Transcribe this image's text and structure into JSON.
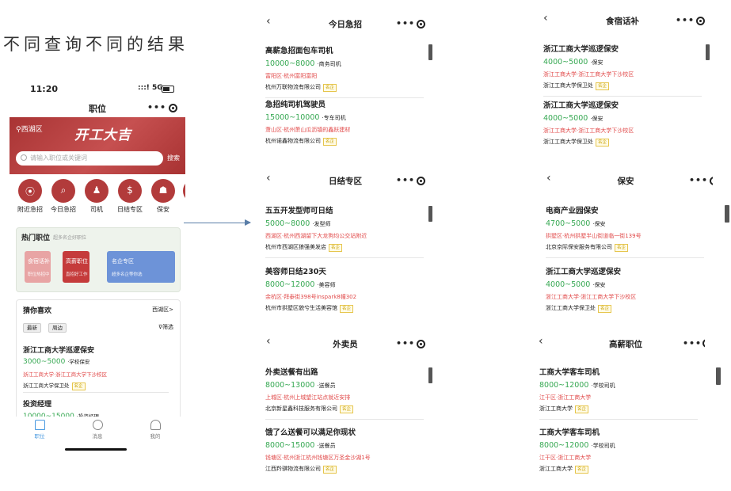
{
  "caption": "不同查询不同的结果",
  "phone": {
    "time": "11:20",
    "signal": "5G",
    "title": "职位",
    "district": "西湖区",
    "slogan": "开工大吉",
    "search_placeholder": "请输入职位或关键词",
    "search_button": "搜索",
    "categories": [
      {
        "label": "附近急招",
        "icon": "⦿"
      },
      {
        "label": "今日急招",
        "icon": "⌕"
      },
      {
        "label": "司机",
        "icon": "♟"
      },
      {
        "label": "日结专区",
        "icon": "$"
      },
      {
        "label": "保安",
        "icon": "☗"
      }
    ],
    "hot": {
      "title": "热门职位",
      "subtitle": "超多名企好职位",
      "tiles": [
        {
          "title": "食宿话补",
          "sub": "职位热招中",
          "color": "#e8a4a4"
        },
        {
          "title": "高薪职位",
          "sub": "直招好工作",
          "color": "#c53b3b"
        },
        {
          "title": "名企专区",
          "sub": "超多名企等你选",
          "color": "#6d93d8"
        }
      ]
    },
    "guess": {
      "title": "猜你喜欢",
      "area": "西湖区>",
      "chips": [
        "最新",
        "周边"
      ],
      "filter": "筛选",
      "job1": {
        "title": "浙江工商大学巡逻保安",
        "salary": "3000~5000",
        "type": "·学校保安",
        "location": "浙江工商大学·浙江工商大学下沙校区",
        "company": "浙江工商大学保卫处",
        "badge": "名企"
      },
      "job2": {
        "title": "投资经理",
        "salary": "10000~15000",
        "type": "·投资经理"
      }
    },
    "tabs": [
      "职位",
      "消息",
      "我的"
    ]
  },
  "panels": [
    {
      "title": "今日急招",
      "jobs": [
        {
          "title": "高薪急招面包车司机",
          "salary": "10000~8000",
          "type": "·商务司机",
          "location": "富阳区·杭州富阳富阳",
          "company": "杭州万联物流有限公司",
          "badge": "名企"
        },
        {
          "title": "急招纯司机驾驶员",
          "salary": "15000~10000",
          "type": "·专车司机",
          "location": "萧山区·杭州萧山瓜沥镇的鑫跃建材",
          "company": "杭州诺鑫物流有限公司",
          "badge": "名企"
        }
      ]
    },
    {
      "title": "食宿话补",
      "jobs": [
        {
          "title": "浙江工商大学巡逻保安",
          "salary": "4000~5000",
          "type": "·保安",
          "location": "浙江工商大学·浙江工商大学下沙校区",
          "company": "浙江工商大学保卫处",
          "badge": "名企"
        },
        {
          "title": "浙江工商大学巡逻保安",
          "salary": "4000~5000",
          "type": "·保安",
          "location": "浙江工商大学·浙江工商大学下沙校区",
          "company": "浙江工商大学保卫处",
          "badge": "名企"
        }
      ]
    },
    {
      "title": "日结专区",
      "jobs": [
        {
          "title": "五五开发型师可日结",
          "salary": "5000~8000",
          "type": "·发型师",
          "location": "西湖区·杭州西湖留下大龙狗均公交站附近",
          "company": "杭州市西湖区狼强美发店",
          "badge": "名企"
        },
        {
          "title": "美容师日结230天",
          "salary": "8000~12000",
          "type": "·美容师",
          "location": "余杭区·拜泰街398号inspark8幢302",
          "company": "杭州市拱墅区貌兮生活美容馆",
          "badge": "名企"
        }
      ]
    },
    {
      "title": "保安",
      "jobs": [
        {
          "title": "电商产业园保安",
          "salary": "4700~5000",
          "type": "·保安",
          "location": "拱墅区·杭州拱墅半山街道临一街139号",
          "company": "北京京际保安服务有限公司",
          "badge": "名企"
        },
        {
          "title": "浙江工商大学巡逻保安",
          "salary": "4000~5000",
          "type": "·保安",
          "location": "浙江工商大学·浙江工商大学下沙校区",
          "company": "浙江工商大学保卫处",
          "badge": "名企"
        }
      ]
    },
    {
      "title": "外卖员",
      "jobs": [
        {
          "title": "外卖送餐有出路",
          "salary": "8000~13000",
          "type": "·送餐员",
          "location": "上城区·杭州上城望江站点就近安排",
          "company": "北京新星鑫科技服务有限公司",
          "badge": "名企"
        },
        {
          "title": "饿了么送餐可以满足你现状",
          "salary": "8000~15000",
          "type": "·送餐员",
          "location": "钱塘区·杭州浙江杭州钱塘区万圣金沙湖1号",
          "company": "江西羚骐物流有限公司",
          "badge": "名企"
        }
      ]
    },
    {
      "title": "高薪职位",
      "jobs": [
        {
          "title": "工商大学客车司机",
          "salary": "8000~12000",
          "type": "·学校司机",
          "location": "江干区·浙江工商大学",
          "company": "浙江工商大学",
          "badge": "名企"
        },
        {
          "title": "工商大学客车司机",
          "salary": "8000~12000",
          "type": "·学校司机",
          "location": "江干区·浙江工商大学",
          "company": "浙江工商大学",
          "badge": "名企"
        }
      ]
    }
  ]
}
